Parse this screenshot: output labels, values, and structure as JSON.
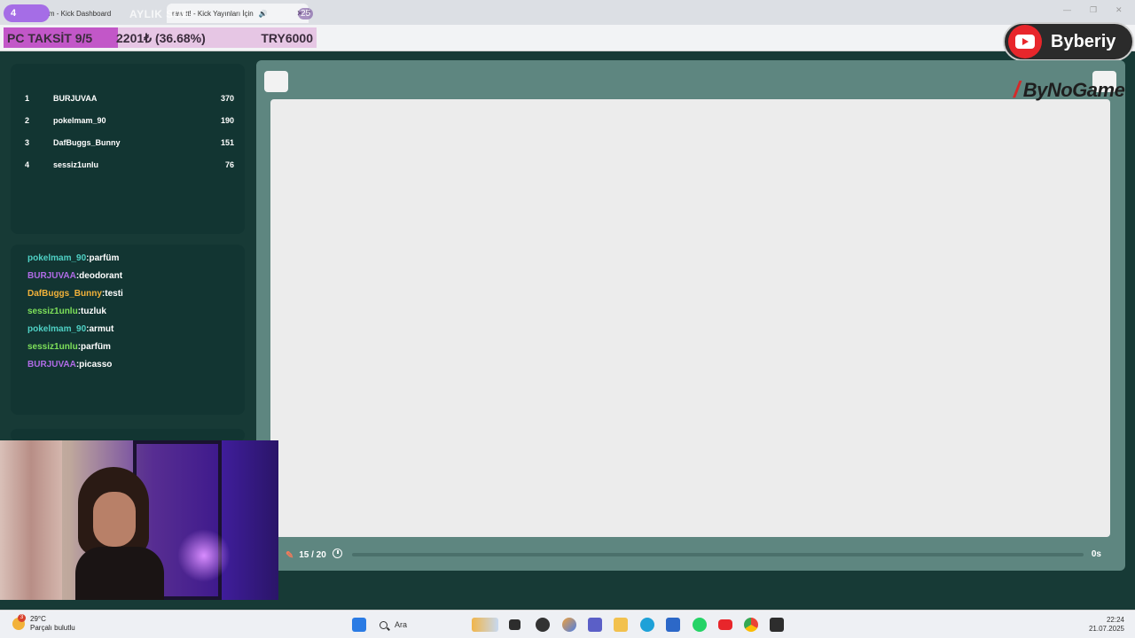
{
  "browser": {
    "tabs": [
      {
        "label": "eam - Kick Dashboard"
      },
      {
        "label": "raw It! - Kick Yayınları İçin"
      }
    ],
    "new_tab_icon": "plus-icon"
  },
  "overlay": {
    "goal_badge": "4",
    "goal_label": "AYLIK SUE",
    "goal_number": "25",
    "taksit": {
      "title": "PC TAKSİT 9/5",
      "progress_text": "2201₺ (36.68%)",
      "target": "TRY6000",
      "progress": 0.3668
    },
    "youtube_badge": {
      "name": "Byberiy",
      "color": "#e8262b"
    },
    "sponsor": "ByNoGame"
  },
  "leaderboard": [
    {
      "rank": "1",
      "name": "BURJUVAA",
      "score": "370"
    },
    {
      "rank": "2",
      "name": "pokelmam_90",
      "score": "190"
    },
    {
      "rank": "3",
      "name": "DafBuggs_Bunny",
      "score": "151"
    },
    {
      "rank": "4",
      "name": "sessiz1unlu",
      "score": "76"
    }
  ],
  "chat": [
    {
      "user": "pokelmam_90",
      "msg": "parfüm",
      "color": "#4fd1c5"
    },
    {
      "user": "BURJUVAA",
      "msg": "deodorant",
      "color": "#b06be6"
    },
    {
      "user": "DafBuggs_Bunny",
      "msg": "testi",
      "color": "#f2b23a"
    },
    {
      "user": "sessiz1unlu",
      "msg": "tuzluk",
      "color": "#7ee05a"
    },
    {
      "user": "pokelmam_90",
      "msg": "armut",
      "color": "#4fd1c5"
    },
    {
      "user": "sessiz1unlu",
      "msg": "parfüm",
      "color": "#7ee05a"
    },
    {
      "user": "BURJUVAA",
      "msg": "picasso",
      "color": "#b06be6"
    }
  ],
  "game": {
    "round": "15 / 20",
    "seconds": "0s",
    "timer_progress": 0
  },
  "taskbar": {
    "weather_temp": "29°C",
    "weather_desc": "Parçalı bulutlu",
    "search_placeholder": "Ara",
    "time": "22:24",
    "date": "21.07.2025"
  }
}
